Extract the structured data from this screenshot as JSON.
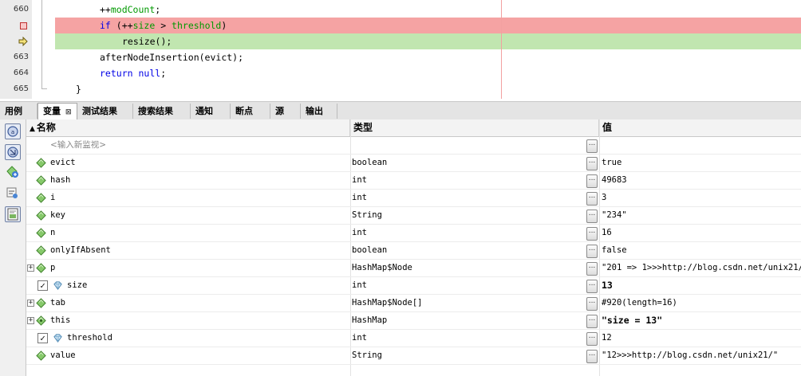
{
  "editor": {
    "lines": [
      {
        "num": "660",
        "marker": "none",
        "highlight": "none",
        "indent": 0
      },
      {
        "num": "",
        "marker": "breakpoint",
        "highlight": "red",
        "indent": 0
      },
      {
        "num": "",
        "marker": "pc-arrow",
        "highlight": "green",
        "indent": 1
      },
      {
        "num": "663",
        "marker": "none",
        "highlight": "none",
        "indent": 0
      },
      {
        "num": "664",
        "marker": "none",
        "highlight": "none",
        "indent": 0
      },
      {
        "num": "665",
        "marker": "none",
        "highlight": "none",
        "indent": -1
      }
    ],
    "code_segments": [
      [
        {
          "t": "++"
        },
        {
          "t": "modCount",
          "c": "fld"
        },
        {
          "t": ";"
        }
      ],
      [
        {
          "t": "if",
          "c": "kw"
        },
        {
          "t": " (++"
        },
        {
          "t": "size",
          "c": "fld"
        },
        {
          "t": " > "
        },
        {
          "t": "threshold",
          "c": "fld"
        },
        {
          "t": ")"
        }
      ],
      [
        {
          "t": "resize();"
        }
      ],
      [
        {
          "t": "afterNodeInsertion(evict);"
        }
      ],
      [
        {
          "t": "return",
          "c": "kw"
        },
        {
          "t": " "
        },
        {
          "t": "null",
          "c": "kw"
        },
        {
          "t": ";"
        }
      ],
      [
        {
          "t": "}"
        }
      ]
    ]
  },
  "tabs": [
    {
      "label": "用例",
      "active": false
    },
    {
      "label": "变量",
      "active": true,
      "closable": "⊠"
    },
    {
      "label": "测试结果",
      "active": false
    },
    {
      "label": "搜索结果",
      "active": false
    },
    {
      "label": "通知",
      "active": false
    },
    {
      "label": "断点",
      "active": false
    },
    {
      "label": "源",
      "active": false
    },
    {
      "label": "输出",
      "active": false
    }
  ],
  "table": {
    "headers": {
      "name": "名称",
      "type": "类型",
      "value": "值"
    },
    "new_watch_placeholder": "<输入新监视>",
    "ellipsis": "...",
    "rows": [
      {
        "name": "evict",
        "type": "boolean",
        "value": "true",
        "icon": "field",
        "expandable": false,
        "watch": false,
        "bold": false
      },
      {
        "name": "hash",
        "type": "int",
        "value": "49683",
        "icon": "field",
        "expandable": false,
        "watch": false,
        "bold": false
      },
      {
        "name": "i",
        "type": "int",
        "value": "3",
        "icon": "field",
        "expandable": false,
        "watch": false,
        "bold": false
      },
      {
        "name": "key",
        "type": "String",
        "value": "\"234\"",
        "icon": "field",
        "expandable": false,
        "watch": false,
        "bold": false
      },
      {
        "name": "n",
        "type": "int",
        "value": "16",
        "icon": "field",
        "expandable": false,
        "watch": false,
        "bold": false
      },
      {
        "name": "onlyIfAbsent",
        "type": "boolean",
        "value": "false",
        "icon": "field",
        "expandable": false,
        "watch": false,
        "bold": false
      },
      {
        "name": "p",
        "type": "HashMap$Node",
        "value": "\"201 => 1>>>http://blog.csdn.net/unix21/\"",
        "icon": "field",
        "expandable": true,
        "watch": false,
        "bold": false
      },
      {
        "name": "size",
        "type": "int",
        "value": "13",
        "icon": "watch",
        "expandable": false,
        "watch": true,
        "bold": true
      },
      {
        "name": "tab",
        "type": "HashMap$Node[]",
        "value": "#920(length=16)",
        "icon": "field",
        "expandable": true,
        "watch": false,
        "bold": false
      },
      {
        "name": "this",
        "type": "HashMap",
        "value": "\"size = 13\"",
        "icon": "this",
        "expandable": true,
        "watch": false,
        "bold": true
      },
      {
        "name": "threshold",
        "type": "int",
        "value": "12",
        "icon": "watch",
        "expandable": false,
        "watch": true,
        "bold": false
      },
      {
        "name": "value",
        "type": "String",
        "value": "\"12>>>http://blog.csdn.net/unix21/\"",
        "icon": "field",
        "expandable": false,
        "watch": false,
        "bold": false
      }
    ]
  },
  "colors": {
    "breakpoint_line": "#f5a3a3",
    "current_line": "#c1e6b0",
    "keyword": "#0000e6",
    "field": "#009900"
  }
}
